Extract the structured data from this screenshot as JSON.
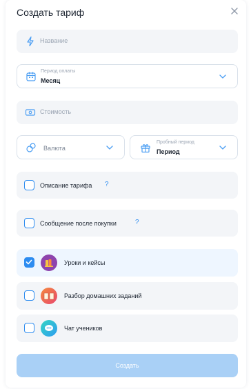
{
  "dialog": {
    "title": "Создать тариф"
  },
  "name_field": {
    "placeholder": "Название"
  },
  "payment_period": {
    "label": "Период оплаты",
    "value": "Месяц"
  },
  "price_field": {
    "placeholder": "Стоимость"
  },
  "currency": {
    "placeholder": "Валюта"
  },
  "trial_period": {
    "label": "Пробный период",
    "value": "Период"
  },
  "options": [
    {
      "label": "Описание тарифа",
      "help": "?",
      "checked": false
    },
    {
      "label": "Сообщение после покупки",
      "help": "?",
      "checked": false
    }
  ],
  "modules": [
    {
      "label": "Уроки и кейсы",
      "checked": true,
      "icon": "books-icon",
      "color": "#8e44ad"
    },
    {
      "label": "Разбор домашних заданий",
      "checked": false,
      "icon": "open-book-icon",
      "color": "#f06a4d"
    },
    {
      "label": "Чат учеников",
      "checked": false,
      "icon": "chat-bubble-icon",
      "color": "#1fc6d6"
    }
  ],
  "actions": {
    "create_label": "Создать"
  },
  "colors": {
    "accent": "#2d8cf0",
    "accent_disabled": "#a9d0f6",
    "field_bg": "#f3f5f8",
    "selected_row_bg": "#eef6ff"
  }
}
